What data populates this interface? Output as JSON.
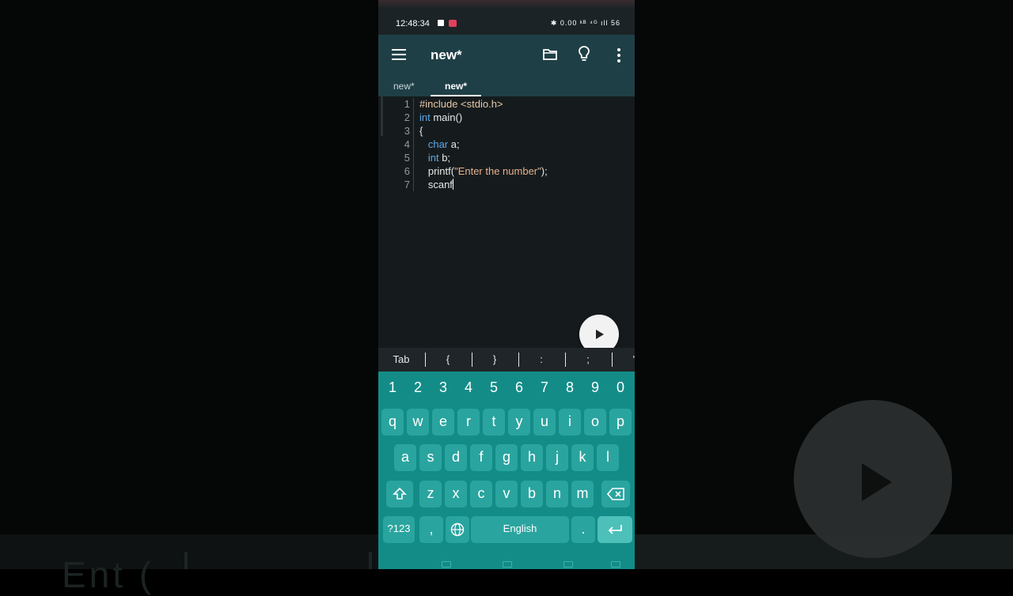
{
  "status": {
    "time": "12:48:34",
    "right_indicators": "✱ 0.00 ᵏᴮ ⁴ᴳ ıll 56"
  },
  "appbar": {
    "title": "new*"
  },
  "tabs": [
    {
      "label": "new*"
    },
    {
      "label": "new*"
    }
  ],
  "editor": {
    "lines": [
      {
        "n": "1",
        "parts": [
          {
            "t": "#include <stdio.h>",
            "c": "inc"
          }
        ]
      },
      {
        "n": "2",
        "parts": [
          {
            "t": "int",
            "c": "kw"
          },
          {
            "t": " main()",
            "c": ""
          }
        ]
      },
      {
        "n": "3",
        "parts": [
          {
            "t": "{",
            "c": ""
          }
        ]
      },
      {
        "n": "4",
        "parts": [
          {
            "t": "   ",
            "c": ""
          },
          {
            "t": "char",
            "c": "kw"
          },
          {
            "t": " a;",
            "c": ""
          }
        ]
      },
      {
        "n": "5",
        "parts": [
          {
            "t": "   ",
            "c": ""
          },
          {
            "t": "int",
            "c": "kw"
          },
          {
            "t": " b;",
            "c": ""
          }
        ]
      },
      {
        "n": "6",
        "parts": [
          {
            "t": "   printf(",
            "c": ""
          },
          {
            "t": "\"Enter the number\"",
            "c": "str"
          },
          {
            "t": ");",
            "c": ""
          }
        ]
      },
      {
        "n": "7",
        "parts": [
          {
            "t": "   scanf",
            "c": ""
          }
        ],
        "caret": true
      }
    ]
  },
  "symbols": [
    "Tab",
    "{",
    "}",
    ":",
    ";",
    "\""
  ],
  "keyboard": {
    "numbers": [
      "1",
      "2",
      "3",
      "4",
      "5",
      "6",
      "7",
      "8",
      "9",
      "0"
    ],
    "row1": [
      "q",
      "w",
      "e",
      "r",
      "t",
      "y",
      "u",
      "i",
      "o",
      "p"
    ],
    "row2": [
      "a",
      "s",
      "d",
      "f",
      "g",
      "h",
      "j",
      "k",
      "l"
    ],
    "row3": [
      "z",
      "x",
      "c",
      "v",
      "b",
      "n",
      "m"
    ],
    "mode_label": "?123",
    "comma": ",",
    "space_label": "English",
    "period": "."
  },
  "background": {
    "ghost_text": "Ent    ( "
  },
  "colors": {
    "appbar": "#1f3f46",
    "keyboard": "#138c87",
    "key": "#2aa49f",
    "keyword": "#5fa8e6"
  }
}
